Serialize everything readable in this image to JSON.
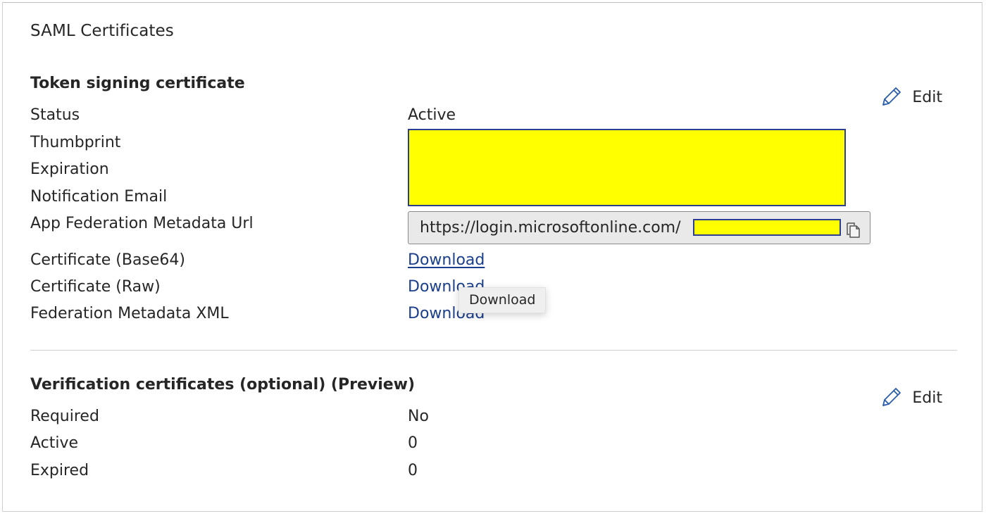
{
  "card": {
    "title": "SAML Certificates"
  },
  "token_signing": {
    "section_title": "Token signing certificate",
    "edit_label": "Edit",
    "rows": {
      "status": {
        "label": "Status",
        "value": "Active"
      },
      "thumbprint": {
        "label": "Thumbprint"
      },
      "expiration": {
        "label": "Expiration"
      },
      "notification_email": {
        "label": "Notification Email"
      },
      "metadata_url": {
        "label": "App Federation Metadata Url",
        "value": "https://login.microsoftonline.com/"
      },
      "cert_base64": {
        "label": "Certificate (Base64)",
        "link": "Download"
      },
      "cert_raw": {
        "label": "Certificate (Raw)",
        "link": "Download"
      },
      "federation_xml": {
        "label": "Federation Metadata XML",
        "link": "Download"
      }
    },
    "tooltip": "Download"
  },
  "verification": {
    "section_title": "Verification certificates (optional) (Preview)",
    "edit_label": "Edit",
    "rows": {
      "required": {
        "label": "Required",
        "value": "No"
      },
      "active": {
        "label": "Active",
        "value": "0"
      },
      "expired": {
        "label": "Expired",
        "value": "0"
      }
    }
  },
  "icons": {
    "edit": "pencil-icon",
    "copy": "copy-icon"
  },
  "colors": {
    "link": "#1b3f8b",
    "redaction_fill": "#ffff00",
    "redaction_border": "#2b3f8e",
    "icon_blue": "#2a5caa"
  }
}
